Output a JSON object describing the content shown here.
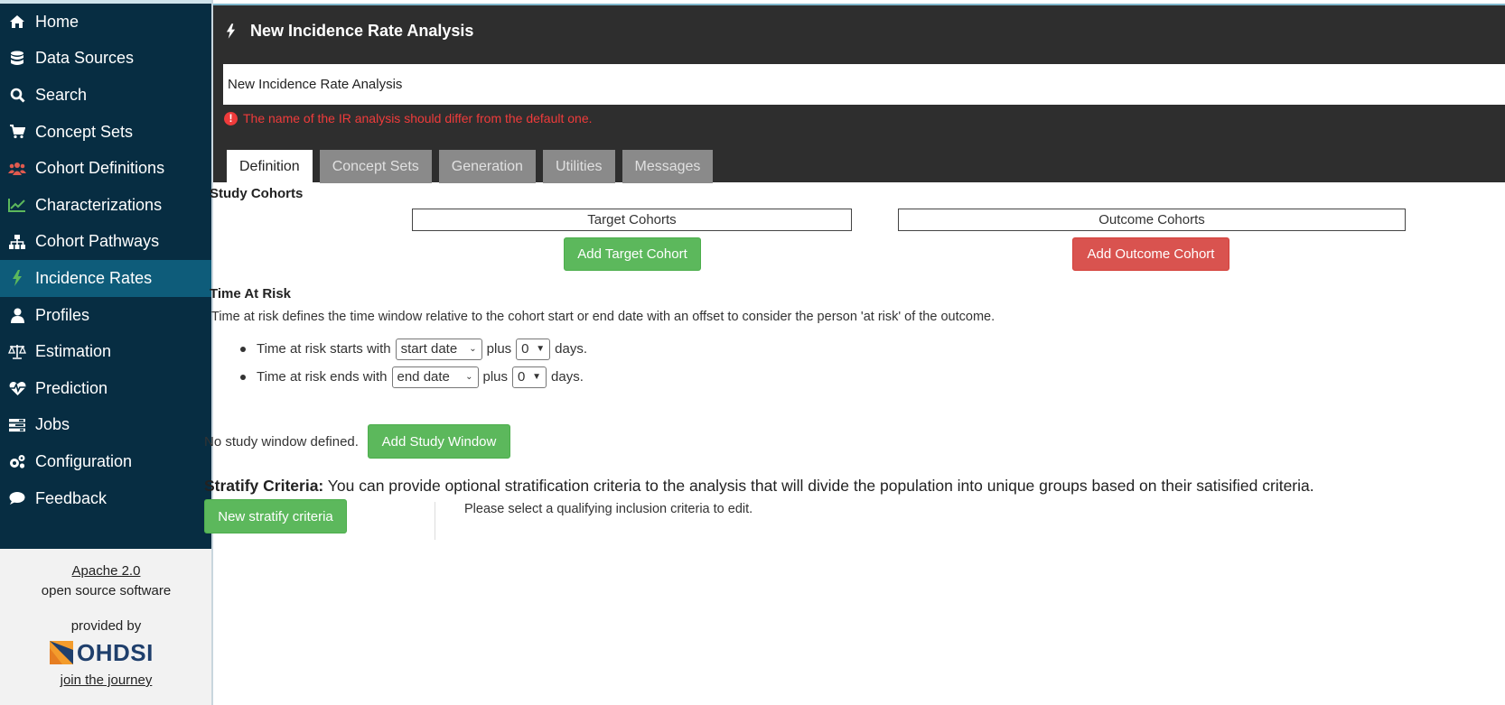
{
  "sidebar": {
    "items": [
      {
        "label": "Home",
        "icon": "home-icon",
        "active": false
      },
      {
        "label": "Data Sources",
        "icon": "database-icon",
        "active": false
      },
      {
        "label": "Search",
        "icon": "search-icon",
        "active": false
      },
      {
        "label": "Concept Sets",
        "icon": "cart-icon",
        "active": false
      },
      {
        "label": "Cohort Definitions",
        "icon": "users-icon",
        "active": false
      },
      {
        "label": "Characterizations",
        "icon": "line-chart-icon",
        "active": false
      },
      {
        "label": "Cohort Pathways",
        "icon": "sitemap-icon",
        "active": false
      },
      {
        "label": "Incidence Rates",
        "icon": "bolt-icon",
        "active": true
      },
      {
        "label": "Profiles",
        "icon": "user-icon",
        "active": false
      },
      {
        "label": "Estimation",
        "icon": "balance-scale-icon",
        "active": false
      },
      {
        "label": "Prediction",
        "icon": "heartbeat-icon",
        "active": false
      },
      {
        "label": "Jobs",
        "icon": "tasks-icon",
        "active": false
      },
      {
        "label": "Configuration",
        "icon": "cogs-icon",
        "active": false
      },
      {
        "label": "Feedback",
        "icon": "comment-icon",
        "active": false
      }
    ],
    "footer": {
      "license_link": "Apache 2.0",
      "license_text": "open source software",
      "provided_by": "provided by",
      "logo_text": "OHDSI",
      "journey_link": "join the journey"
    }
  },
  "header": {
    "title": "New Incidence Rate Analysis",
    "name_value": "New Incidence Rate Analysis",
    "validation_message": "The name of the IR analysis should differ from the default one.",
    "tabs": [
      {
        "label": "Definition",
        "active": true
      },
      {
        "label": "Concept Sets",
        "active": false
      },
      {
        "label": "Generation",
        "active": false
      },
      {
        "label": "Utilities",
        "active": false
      },
      {
        "label": "Messages",
        "active": false
      }
    ]
  },
  "study_cohorts": {
    "heading": "Study Cohorts",
    "target_label": "Target Cohorts",
    "outcome_label": "Outcome Cohorts",
    "add_target_button": "Add Target Cohort",
    "add_outcome_button": "Add Outcome Cohort"
  },
  "time_at_risk": {
    "heading": "Time At Risk",
    "description": "Time at risk defines the time window relative to the cohort start or end date with an offset to consider the person 'at risk' of the outcome.",
    "start": {
      "prefix": "Time at risk starts with",
      "date_option": "start date",
      "plus": "plus",
      "offset": "0",
      "suffix": "days."
    },
    "end": {
      "prefix": "Time at risk ends with",
      "date_option": "end date",
      "plus": "plus",
      "offset": "0",
      "suffix": "days."
    }
  },
  "study_window": {
    "text": "No study window defined.",
    "button": "Add Study Window"
  },
  "stratify": {
    "label": "Stratify Criteria:",
    "description": " You can provide optional stratification criteria to the analysis that will divide the population into unique groups based on their satisified criteria.",
    "button": "New stratify criteria",
    "hint": "Please select a qualifying inclusion criteria to edit."
  },
  "colors": {
    "nav_bg": "#072d42",
    "nav_active": "#0e5c7a",
    "header_bg": "#2e2e2e",
    "success": "#5cb85c",
    "danger": "#d9534f",
    "error_text": "#ef3b3b"
  }
}
